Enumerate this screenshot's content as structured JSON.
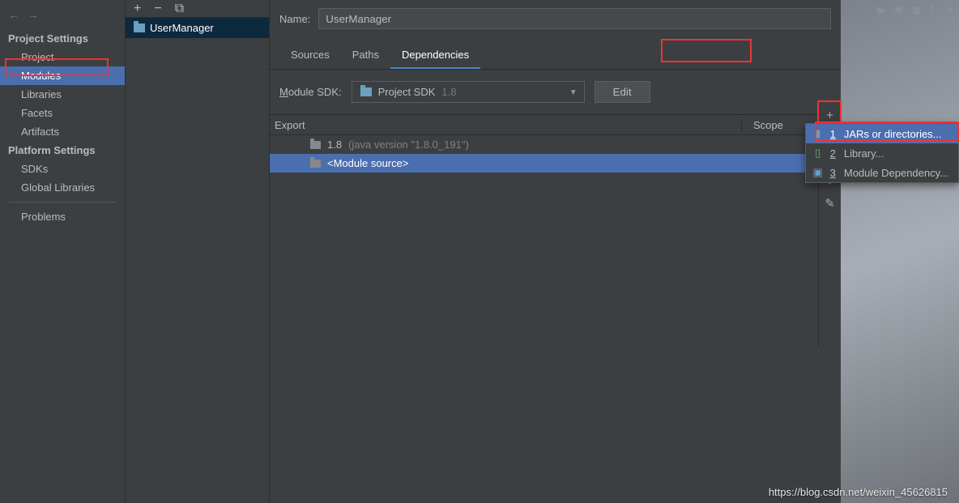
{
  "sidebar": {
    "project_settings_title": "Project Settings",
    "items_project": "Project",
    "items_modules": "Modules",
    "items_libraries": "Libraries",
    "items_facets": "Facets",
    "items_artifacts": "Artifacts",
    "platform_settings_title": "Platform Settings",
    "items_sdks": "SDKs",
    "items_global_libs": "Global Libraries",
    "items_problems": "Problems"
  },
  "tree": {
    "module_name": "UserManager"
  },
  "main": {
    "name_label": "Name:",
    "name_value": "UserManager",
    "tabs": {
      "sources": "Sources",
      "paths": "Paths",
      "dependencies": "Dependencies"
    },
    "sdk_label_pre": "M",
    "sdk_label_rest": "odule SDK:",
    "sdk_value_prefix": "Project SDK",
    "sdk_value_suffix": "1.8",
    "edit_label": "Edit",
    "headers": {
      "export": "Export",
      "scope": "Scope"
    },
    "dep_rows": [
      {
        "name": "1.8",
        "detail": "(java version \"1.8.0_191\")"
      },
      {
        "name": "<Module source>",
        "detail": ""
      }
    ]
  },
  "popup": {
    "jars": "JARs or directories...",
    "library": "Library...",
    "module_dep": "Module Dependency..."
  },
  "watermark": "https://blog.csdn.net/weixin_45626815"
}
